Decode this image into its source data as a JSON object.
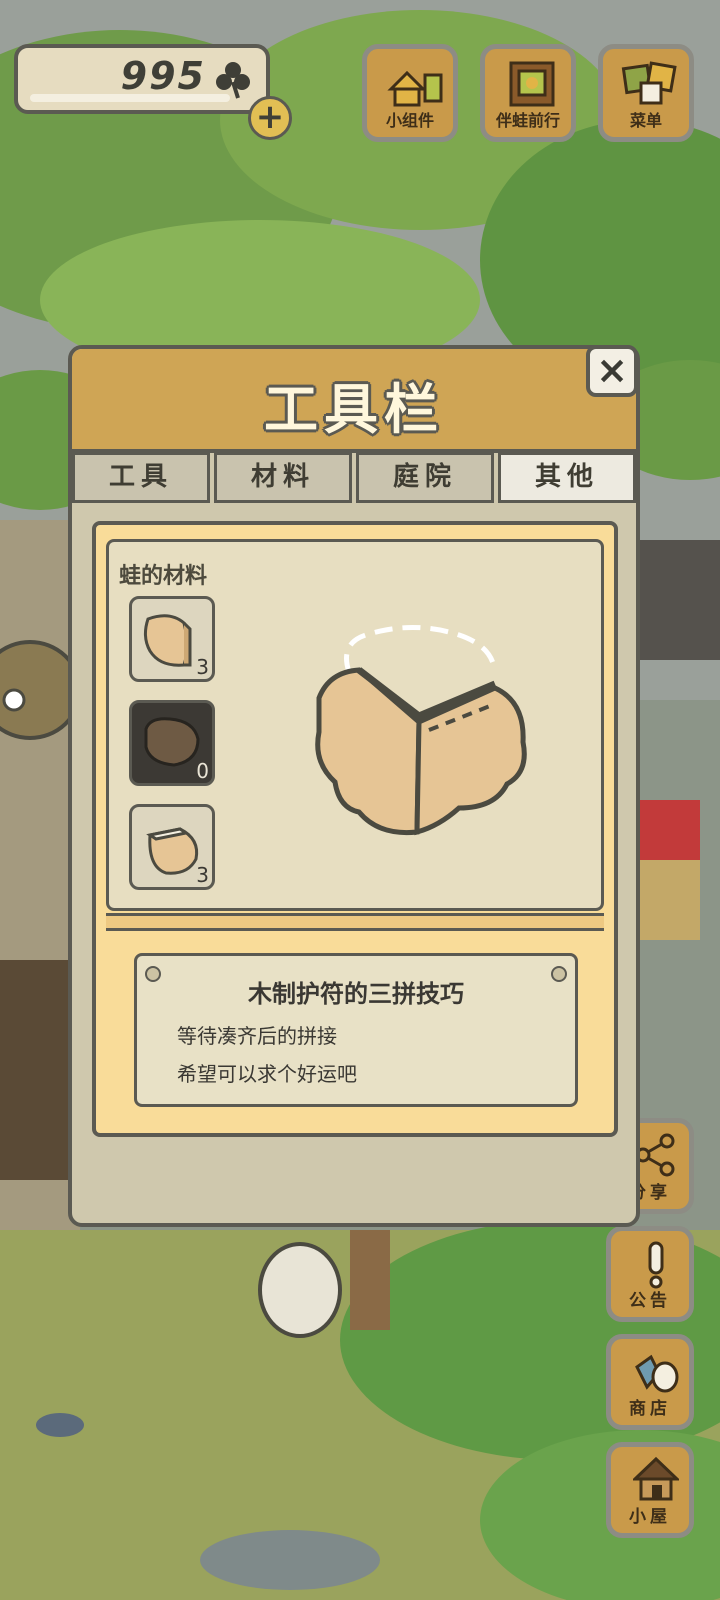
{
  "hud": {
    "clover_count": "995",
    "plus_label": "+",
    "buttons": [
      {
        "label": "小组件",
        "icon": "widget-icon"
      },
      {
        "label": "伴蛙前行",
        "icon": "photo-album-icon"
      },
      {
        "label": "菜单",
        "icon": "menu-cards-icon"
      }
    ]
  },
  "side_buttons": [
    {
      "label": "分享",
      "icon": "share-icon"
    },
    {
      "label": "公告",
      "icon": "exclamation-icon"
    },
    {
      "label": "商店",
      "icon": "shop-bag-icon"
    },
    {
      "label": "小屋",
      "icon": "house-icon"
    }
  ],
  "dialog": {
    "title": "工具栏",
    "close_label": "×",
    "tabs": [
      "工具",
      "材料",
      "庭院",
      "其他"
    ],
    "active_tab": "其他",
    "category_label": "蛙的材料",
    "items": [
      {
        "count": "3",
        "icon": "amulet-piece-light-icon"
      },
      {
        "count": "0",
        "icon": "amulet-piece-dark-icon"
      },
      {
        "count": "3",
        "icon": "amulet-piece-right-icon"
      }
    ],
    "description": {
      "title": "木制护符的三拼技巧",
      "lines": [
        "等待凑齐后的拼接",
        "希望可以求个好运吧"
      ]
    }
  },
  "colors": {
    "wood_button": "#c99a4a",
    "dialog_header": "#cfa555",
    "panel_yellow": "#f9dc99",
    "outline": "#5b5a52"
  }
}
